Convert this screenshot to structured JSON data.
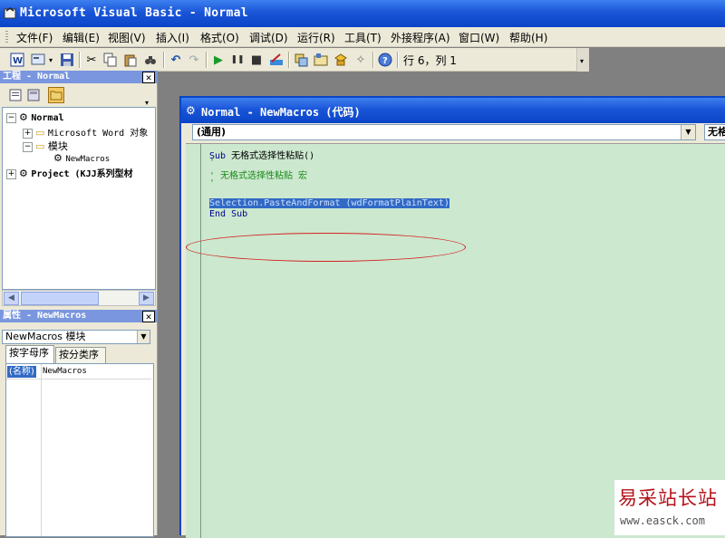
{
  "app": {
    "title": "Microsoft Visual Basic - Normal"
  },
  "menu": [
    "文件(F)",
    "编辑(E)",
    "视图(V)",
    "插入(I)",
    "格式(O)",
    "调试(D)",
    "运行(R)",
    "工具(T)",
    "外接程序(A)",
    "窗口(W)",
    "帮助(H)"
  ],
  "toolbar": {
    "position": "行 6，列 1"
  },
  "project_panel": {
    "title": "工程 - Normal",
    "tree": {
      "root": "Normal",
      "word_objects": "Microsoft Word 对象",
      "modules": "模块",
      "module_item": "NewMacros",
      "project2": "Project (KJJ系列型材"
    }
  },
  "properties_panel": {
    "title": "属性 - NewMacros",
    "object": "NewMacros 模块",
    "tabs": [
      "按字母序",
      "按分类序"
    ],
    "row": {
      "name": "(名称)",
      "value": "NewMacros"
    }
  },
  "code_window": {
    "title": "Normal - NewMacros (代码)",
    "object_combo": "(通用)",
    "proc_combo": "无格",
    "lines": {
      "l1_kw": "Sub",
      "l1_rest": " 无格式选择性粘贴()",
      "l2": "'",
      "l3": "' 无格式选择性粘贴 宏",
      "l4": "'",
      "l5": "Selection.PasteAndFormat (wdFormatPlainText)",
      "l6": "End Sub"
    }
  },
  "watermark": {
    "title": "易采站长站",
    "url": "www.easck.com"
  },
  "colors": {
    "titlebar": "#0a45c8",
    "code_bg": "#cce8cf",
    "selection": "#316ac5",
    "annotation": "#d42020"
  }
}
